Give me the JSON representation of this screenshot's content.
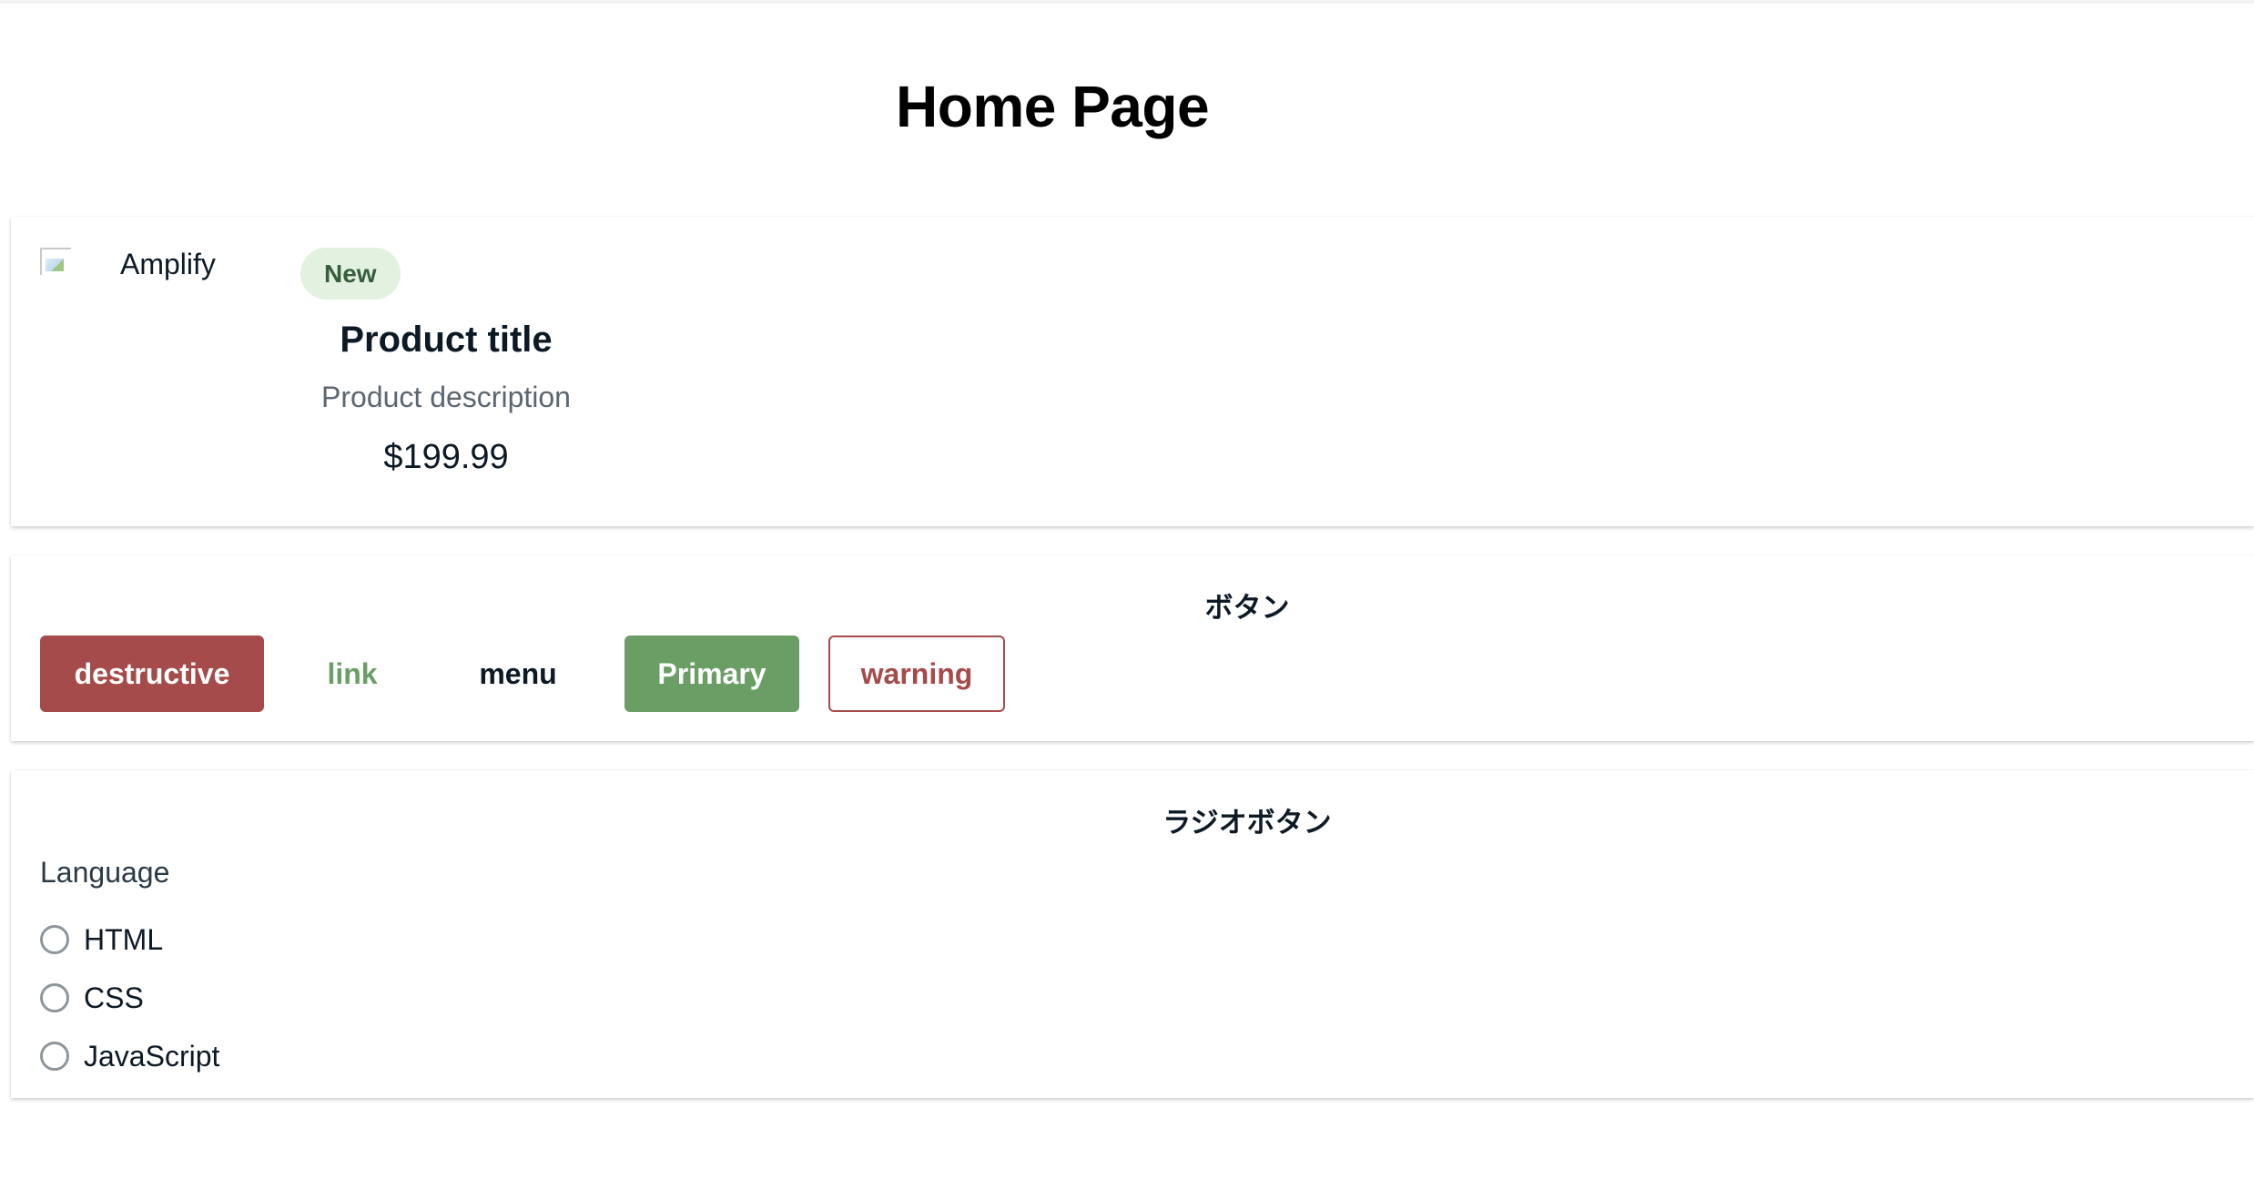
{
  "page": {
    "title": "Home Page"
  },
  "product_card": {
    "image_alt": "Amplify",
    "badge": "New",
    "title": "Product title",
    "description": "Product description",
    "price": "$199.99"
  },
  "buttons_section": {
    "heading": "ボタン",
    "buttons": [
      {
        "label": "destructive",
        "variation": "destructive"
      },
      {
        "label": "link",
        "variation": "link"
      },
      {
        "label": "menu",
        "variation": "menu"
      },
      {
        "label": "Primary",
        "variation": "primary"
      },
      {
        "label": "warning",
        "variation": "warning"
      }
    ]
  },
  "radio_section": {
    "heading": "ラジオボタン",
    "group_label": "Language",
    "options": [
      "HTML",
      "CSS",
      "JavaScript"
    ],
    "selected": null
  },
  "colors": {
    "destructive": "#a64b4b",
    "primary": "#6a9e65",
    "badge_bg": "#e3f1e0",
    "text": "#0d1a26"
  }
}
